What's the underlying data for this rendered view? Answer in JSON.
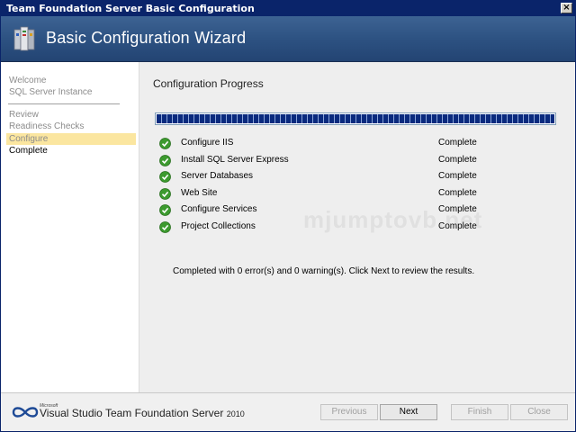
{
  "window": {
    "title": "Team Foundation Server Basic Configuration",
    "close_glyph": "×"
  },
  "header": {
    "title": "Basic Configuration Wizard",
    "icon": "server-config-icon"
  },
  "sidebar": {
    "items": [
      {
        "label": "Welcome",
        "state": "inactive"
      },
      {
        "label": "SQL Server Instance",
        "state": "inactive"
      },
      {
        "label": "Review",
        "state": "inactive"
      },
      {
        "label": "Readiness Checks",
        "state": "inactive"
      },
      {
        "label": "Configure",
        "state": "current"
      },
      {
        "label": "Complete",
        "state": "active"
      }
    ]
  },
  "main": {
    "section_title": "Configuration Progress",
    "progress_percent": 100,
    "tasks": [
      {
        "name": "Configure IIS",
        "status": "Complete"
      },
      {
        "name": "Install SQL Server Express",
        "status": "Complete"
      },
      {
        "name": "Server Databases",
        "status": "Complete"
      },
      {
        "name": "Web Site",
        "status": "Complete"
      },
      {
        "name": "Configure Services",
        "status": "Complete"
      },
      {
        "name": "Project Collections",
        "status": "Complete"
      }
    ],
    "result_message": "Completed with 0 error(s) and 0 warning(s). Click Next to review the results."
  },
  "watermark": "mjumptovb.net",
  "footer": {
    "brand_microsoft": "Microsoft",
    "brand_name": "Visual Studio Team Foundation Server",
    "brand_year": "2010",
    "buttons": {
      "previous": "Previous",
      "next": "Next",
      "finish": "Finish",
      "close": "Close"
    }
  },
  "colors": {
    "titlebar": "#0a246a",
    "header": "#2d5282",
    "current_step_highlight": "#fbe6a0",
    "progress_fill": "#0a2a7e",
    "check_green": "#3c9a2e"
  }
}
